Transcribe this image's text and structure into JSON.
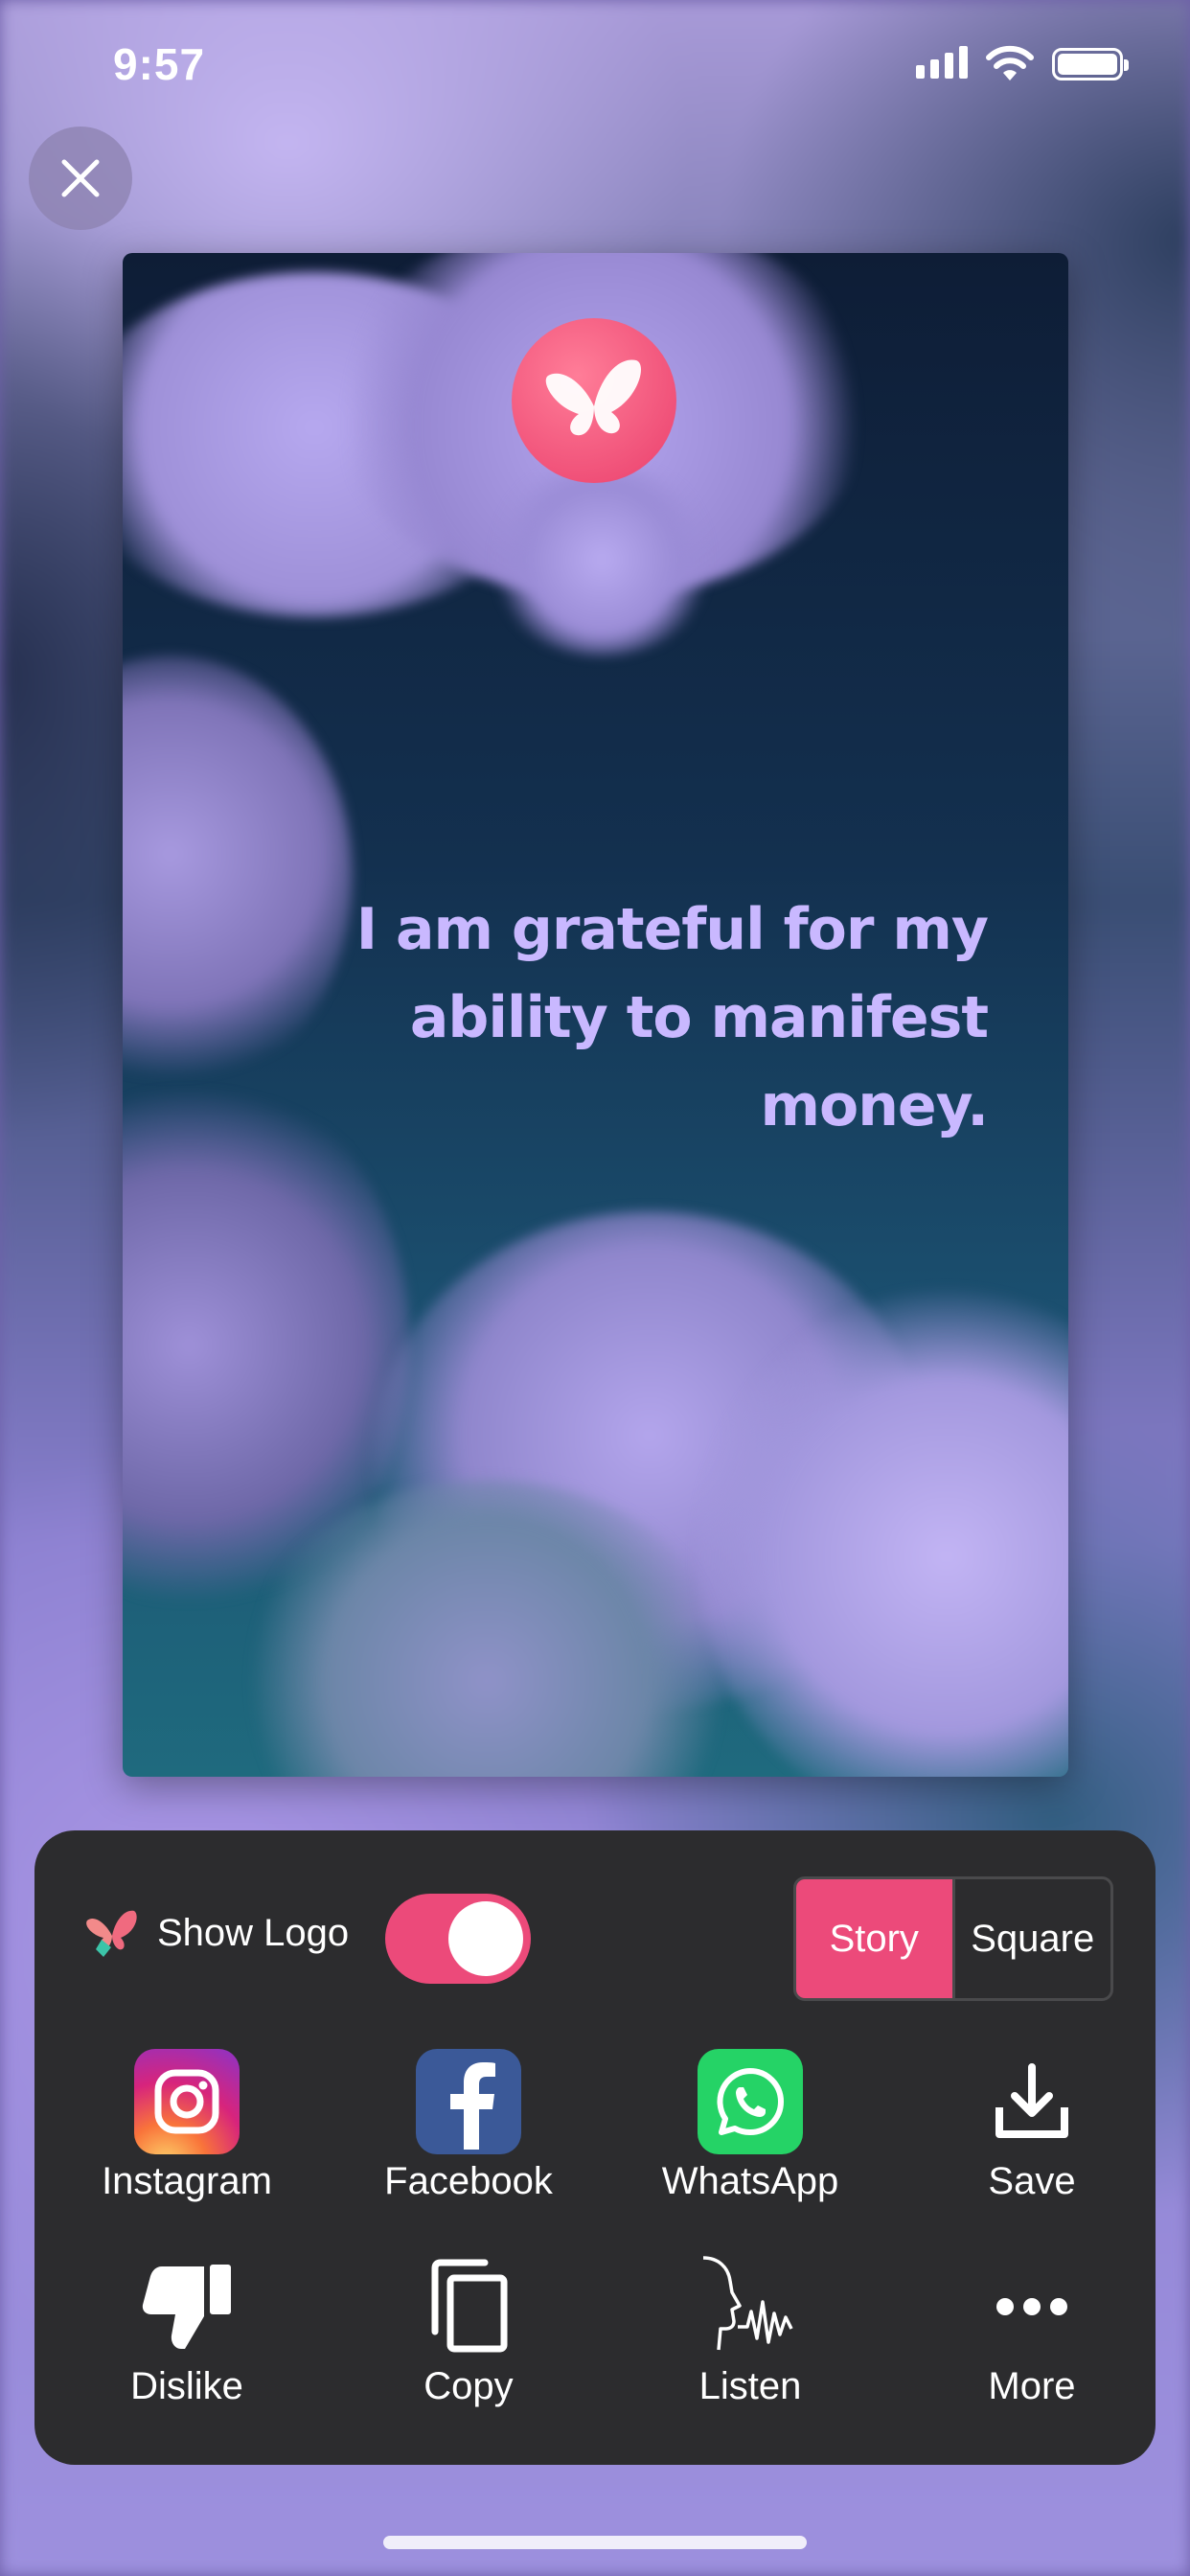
{
  "status_bar": {
    "time": "9:57"
  },
  "card": {
    "quote": "I am grateful for my ability to manifest money."
  },
  "share_panel": {
    "show_logo_label": "Show Logo",
    "show_logo_on": true,
    "format_options": [
      "Story",
      "Square"
    ],
    "selected_format": "Story",
    "actions_row1": [
      {
        "label": "Instagram",
        "icon": "instagram-icon"
      },
      {
        "label": "Facebook",
        "icon": "facebook-icon"
      },
      {
        "label": "WhatsApp",
        "icon": "whatsapp-icon"
      },
      {
        "label": "Save",
        "icon": "download-icon"
      }
    ],
    "actions_row2": [
      {
        "label": "Dislike",
        "icon": "thumbs-down-icon"
      },
      {
        "label": "Copy",
        "icon": "copy-icon"
      },
      {
        "label": "Listen",
        "icon": "speaking-head-icon"
      },
      {
        "label": "More",
        "icon": "more-icon"
      }
    ]
  },
  "colors": {
    "accent": "#EC4A7A",
    "panel": "#2C2C2E",
    "quote_text": "#C9B8FF"
  }
}
